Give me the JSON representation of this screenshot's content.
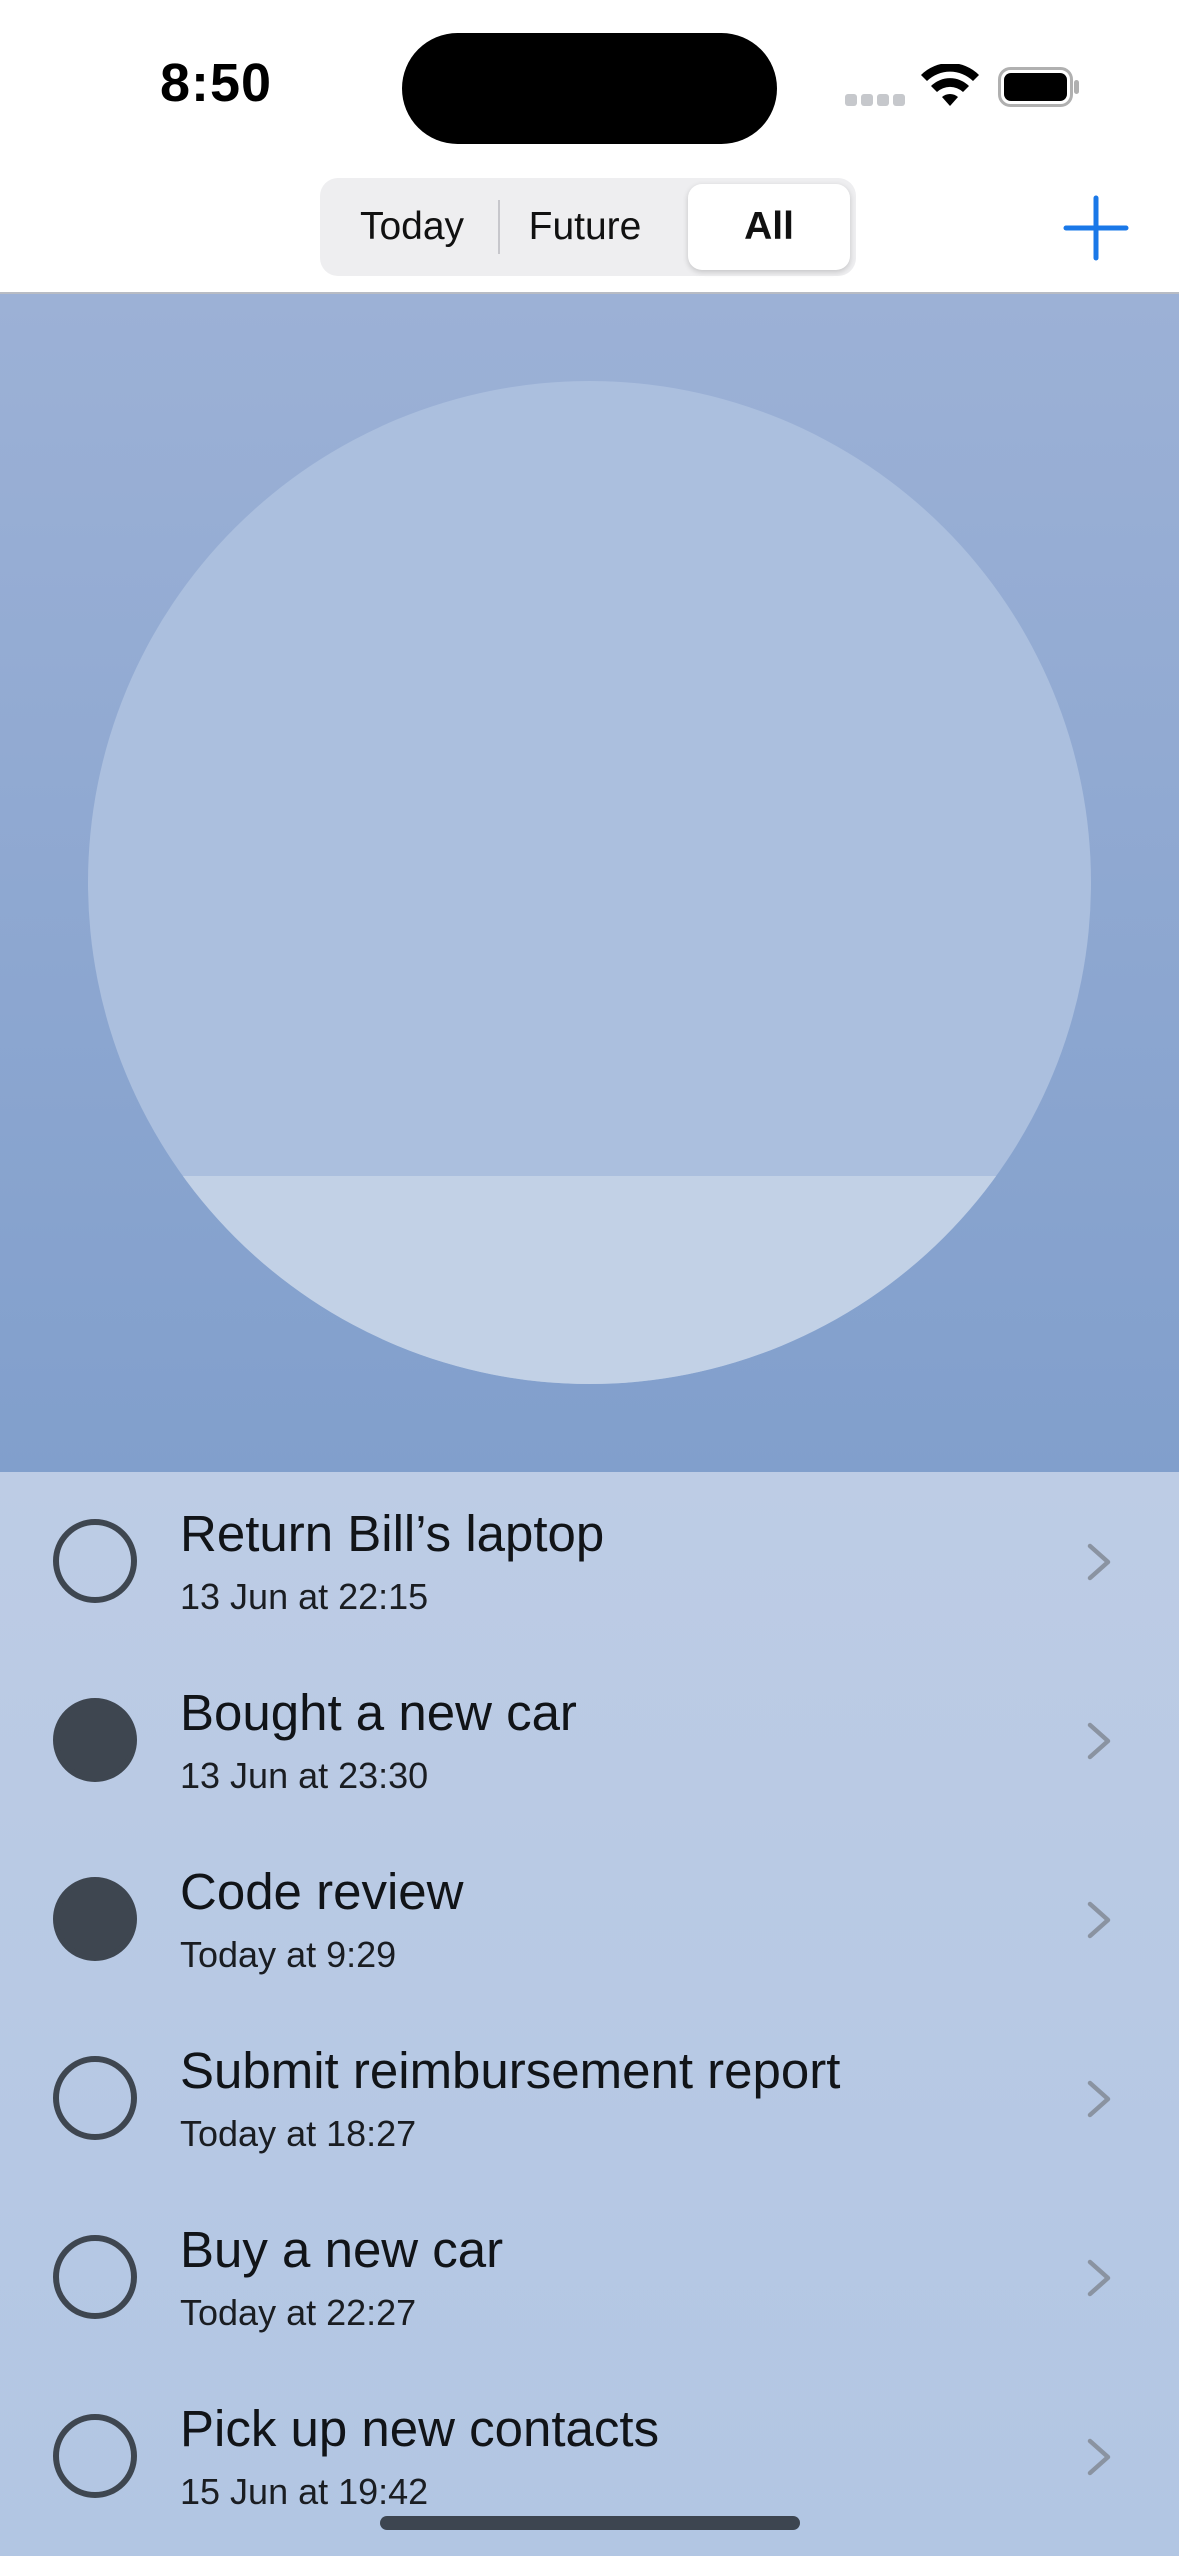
{
  "status_bar": {
    "time": "8:50"
  },
  "nav": {
    "segments": [
      "Today",
      "Future",
      "All"
    ],
    "selected_segment": "All",
    "add_icon": "plus-icon",
    "accent_color": "#1a78e8"
  },
  "tasks": [
    {
      "title": "Return Bill’s laptop",
      "date": "13 Jun at 22:15",
      "completed": false
    },
    {
      "title": "Bought a new car",
      "date": "13 Jun at 23:30",
      "completed": true
    },
    {
      "title": "Code review",
      "date": "Today at 9:29",
      "completed": true
    },
    {
      "title": "Submit reimbursement report",
      "date": "Today at 18:27",
      "completed": false
    },
    {
      "title": "Buy a new car",
      "date": "Today at 22:27",
      "completed": false
    },
    {
      "title": "Pick up new contacts",
      "date": "15 Jun at 19:42",
      "completed": false
    }
  ]
}
